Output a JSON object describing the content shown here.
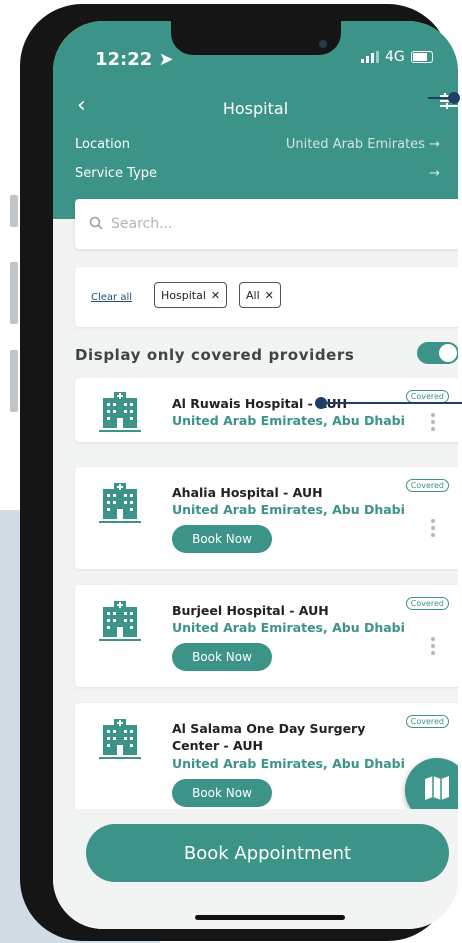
{
  "status_bar": {
    "time": "12:22",
    "network": "4G"
  },
  "header": {
    "title": "Hospital"
  },
  "filters": [
    {
      "label": "Location",
      "value": "United Arab Emirates"
    },
    {
      "label": "Service Type",
      "value": ""
    }
  ],
  "search": {
    "placeholder": "Search..."
  },
  "chips": {
    "clear_label": "Clear all",
    "items": [
      "Hospital",
      "All"
    ]
  },
  "display_toggle": {
    "label": "Display only covered providers",
    "on": true
  },
  "providers": [
    {
      "name": "Al Ruwais Hospital - AUH",
      "location": "United Arab Emirates, Abu Dhabi",
      "badge": "Covered",
      "cta": ""
    },
    {
      "name": "Ahalia Hospital - AUH",
      "location": "United Arab Emirates, Abu Dhabi",
      "badge": "Covered",
      "cta": "Book Now"
    },
    {
      "name": "Burjeel Hospital - AUH",
      "location": "United Arab Emirates, Abu Dhabi",
      "badge": "Covered",
      "cta": "Book Now"
    },
    {
      "name": "Al Salama One Day Surgery Center - AUH",
      "location": "United Arab Emirates, Abu Dhabi",
      "badge": "Covered",
      "cta": "Book Now"
    }
  ],
  "book_appointment": {
    "label": "Book Appointment"
  },
  "colors": {
    "primary": "#3c9387",
    "callout": "#1f3f66",
    "background": "#f2f3f3"
  },
  "icons": [
    "back-chevron-icon",
    "filter-sliders-icon",
    "arrow-right-icon",
    "search-icon",
    "close-icon",
    "hospital-icon",
    "kebab-menu-icon",
    "map-icon"
  ]
}
